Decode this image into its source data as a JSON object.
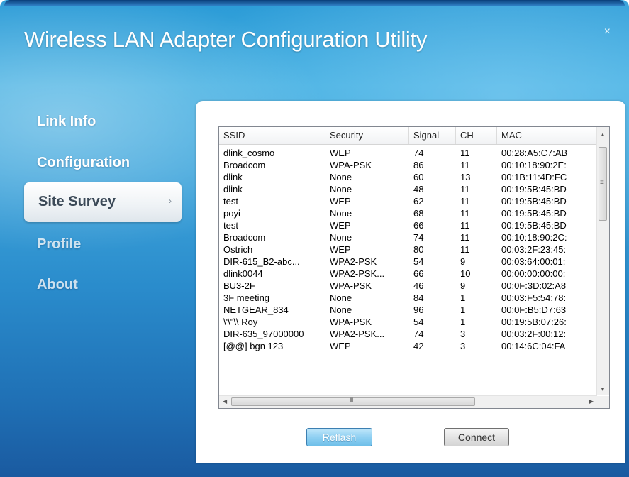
{
  "window": {
    "title": "Wireless LAN Adapter Configuration Utility",
    "close_glyph": "×"
  },
  "nav": {
    "items": [
      {
        "label": "Link Info"
      },
      {
        "label": "Configuration"
      },
      {
        "label": "Site Survey",
        "active": true
      },
      {
        "label": "Profile"
      },
      {
        "label": "About"
      }
    ]
  },
  "table": {
    "columns": [
      "SSID",
      "Security",
      "Signal",
      "CH",
      "MAC"
    ],
    "rows": [
      [
        "dlink_cosmo",
        "WEP",
        "74",
        "11",
        "00:28:A5:C7:AB"
      ],
      [
        "Broadcom",
        "WPA-PSK",
        "86",
        "11",
        "00:10:18:90:2E:"
      ],
      [
        "dlink",
        "None",
        "60",
        "13",
        "00:1B:11:4D:FC"
      ],
      [
        "dlink",
        "None",
        "48",
        "11",
        "00:19:5B:45:BD"
      ],
      [
        "test",
        "WEP",
        "62",
        "11",
        "00:19:5B:45:BD"
      ],
      [
        "poyi",
        "None",
        "68",
        "11",
        "00:19:5B:45:BD"
      ],
      [
        "test",
        "WEP",
        "66",
        "11",
        "00:19:5B:45:BD"
      ],
      [
        "Broadcom",
        "None",
        "74",
        "11",
        "00:10:18:90:2C:"
      ],
      [
        "Ostrich",
        "WEP",
        "80",
        "11",
        "00:03:2F:23:45:"
      ],
      [
        "DIR-615_B2-abc...",
        "WPA2-PSK",
        "54",
        "9",
        "00:03:64:00:01:"
      ],
      [
        "dlink0044",
        "WPA2-PSK...",
        "66",
        "10",
        "00:00:00:00:00:"
      ],
      [
        "BU3-2F",
        "WPA-PSK",
        "46",
        "9",
        "00:0F:3D:02:A8"
      ],
      [
        "3F meeting",
        "None",
        "84",
        "1",
        "00:03:F5:54:78:"
      ],
      [
        "NETGEAR_834",
        "None",
        "96",
        "1",
        "00:0F:B5:D7:63"
      ],
      [
        "\\'\\\"\\\\   Roy",
        "WPA-PSK",
        "54",
        "1",
        "00:19:5B:07:26:"
      ],
      [
        "DIR-635_97000000",
        "WPA2-PSK...",
        "74",
        "3",
        "00:03:2F:00:12:"
      ],
      [
        "[@@] bgn 123",
        "WEP",
        "42",
        "3",
        "00:14:6C:04:FA"
      ]
    ],
    "scrollbar": {
      "up": "▲",
      "down": "▼",
      "left": "◀",
      "right": "▶",
      "vgrip": "≡",
      "hgrip": "III"
    }
  },
  "buttons": {
    "reflash": "Reflash",
    "connect": "Connect"
  },
  "nav_arrow": "›"
}
